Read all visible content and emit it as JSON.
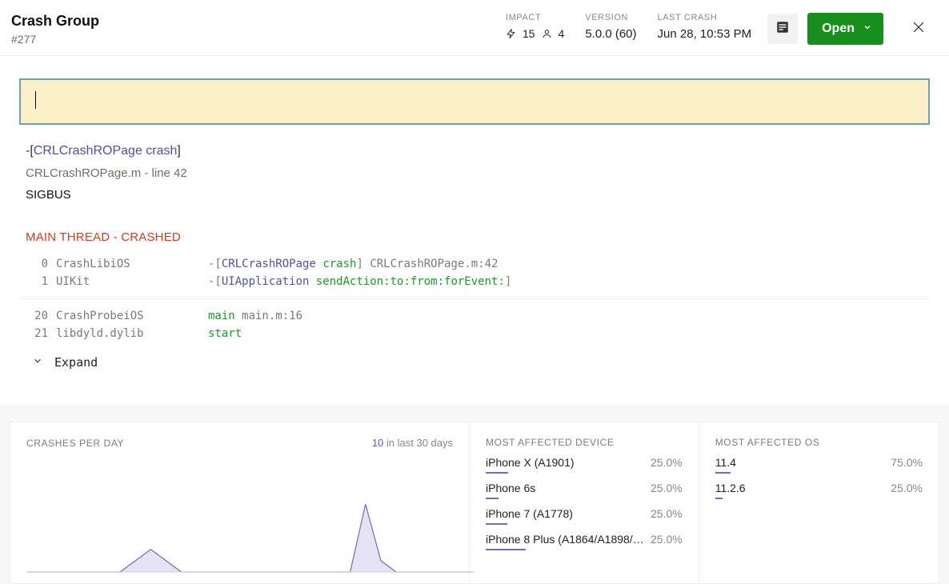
{
  "header": {
    "title": "Crash Group",
    "issue_id": "#277",
    "impact_label": "IMPACT",
    "impact_crashes": "15",
    "impact_users": "4",
    "version_label": "VERSION",
    "version_value": "5.0.0 (60)",
    "last_crash_label": "LAST CRASH",
    "last_crash_value": "Jun 28, 10:53 PM",
    "open_label": "Open"
  },
  "annotation": {
    "value": ""
  },
  "summary": {
    "method_prefix": "-[",
    "method_class": "CRLCrashROPage",
    "method_name": "crash",
    "method_suffix": "]",
    "file_line": "CRLCrashROPage.m - line 42",
    "signal": "SIGBUS"
  },
  "thread": {
    "title": "MAIN THREAD - CRASHED",
    "expand_label": "Expand",
    "frames_top": [
      {
        "idx": "0",
        "lib": "CrashLibiOS",
        "prefix": "-[",
        "cls": "CRLCrashROPage",
        "meth": "crash",
        "suffix": "] ",
        "loc": "CRLCrashROPage.m:42"
      },
      {
        "idx": "1",
        "lib": "UIKit",
        "prefix": "-[",
        "cls": "UIApplication",
        "meth": "sendAction:to:from:forEvent:",
        "suffix": "]",
        "loc": ""
      }
    ],
    "frames_bottom": [
      {
        "idx": "20",
        "lib": "CrashProbeiOS",
        "entry": "main",
        "loc": " main.m:16"
      },
      {
        "idx": "21",
        "lib": "libdyld.dylib",
        "entry": "start",
        "loc": ""
      }
    ]
  },
  "chart_data": {
    "type": "area",
    "title": "CRASHES PER DAY",
    "subtitle_count": "10",
    "subtitle_rest": " in last 30 days",
    "x": [
      0,
      1,
      2,
      3,
      4,
      5,
      6,
      7,
      8,
      9,
      10,
      11,
      12,
      13,
      14,
      15,
      16,
      17,
      18,
      19,
      20,
      21,
      22,
      23,
      24,
      25,
      26,
      27,
      28,
      29
    ],
    "values": [
      0,
      0,
      0,
      0,
      0,
      0,
      0,
      1,
      2,
      1,
      0,
      0,
      0,
      0,
      0,
      0,
      0,
      0,
      0,
      0,
      0,
      0,
      6,
      1,
      0,
      0,
      0,
      0,
      0,
      0
    ],
    "ylim": [
      0,
      8
    ]
  },
  "devices": {
    "label": "MOST AFFECTED DEVICE",
    "rows": [
      {
        "name": "iPhone X (A1901)",
        "pct": "25.0%",
        "bar": 25
      },
      {
        "name": "iPhone 6s",
        "pct": "25.0%",
        "bar": 25
      },
      {
        "name": "iPhone 7 (A1778)",
        "pct": "25.0%",
        "bar": 25
      },
      {
        "name": "iPhone 8 Plus (A1864/A1898/A...",
        "pct": "25.0%",
        "bar": 25
      }
    ]
  },
  "os": {
    "label": "MOST AFFECTED OS",
    "rows": [
      {
        "name": "11.4",
        "pct": "75.0%",
        "bar": 75
      },
      {
        "name": "11.2.6",
        "pct": "25.0%",
        "bar": 25
      }
    ]
  }
}
